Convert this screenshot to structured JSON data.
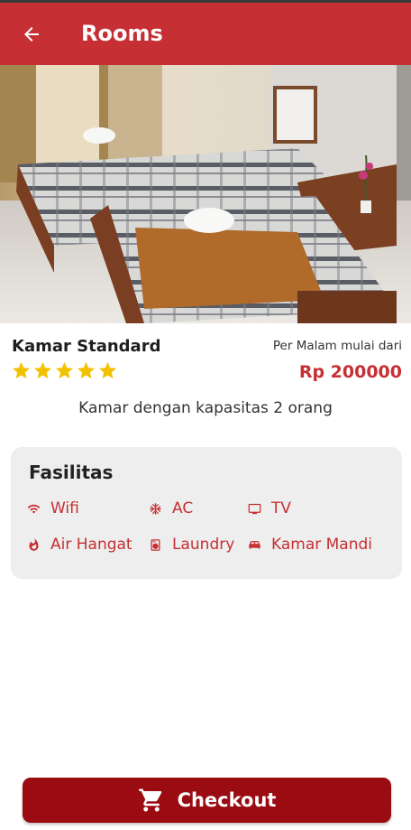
{
  "appbar": {
    "title": "Rooms",
    "back_icon": "arrow-left-icon",
    "background": "#c62f33"
  },
  "carousel": {
    "image_description": "Hotel room with two single beds",
    "slide_count": 4,
    "active_index": 2
  },
  "room": {
    "name": "Kamar Standard",
    "price_caption": "Per Malam mulai dari",
    "price": "Rp 200000",
    "rating": 5,
    "rating_max": 5,
    "description": "Kamar dengan kapasitas 2 orang"
  },
  "facilities": {
    "title": "Fasilitas",
    "items": [
      {
        "label": "Wifi",
        "icon": "wifi-icon"
      },
      {
        "label": "AC",
        "icon": "snowflake-icon"
      },
      {
        "label": "TV",
        "icon": "tv-icon"
      },
      {
        "label": "Air Hangat",
        "icon": "fire-icon"
      },
      {
        "label": "Laundry",
        "icon": "washing-machine-icon"
      },
      {
        "label": "Kamar Mandi",
        "icon": "bed-icon"
      }
    ]
  },
  "checkout": {
    "label": "Checkout",
    "icon": "cart-icon"
  },
  "colors": {
    "accent": "#c62f33",
    "button": "#9a0b12",
    "star": "#f2c200",
    "card": "#eeeeee"
  }
}
